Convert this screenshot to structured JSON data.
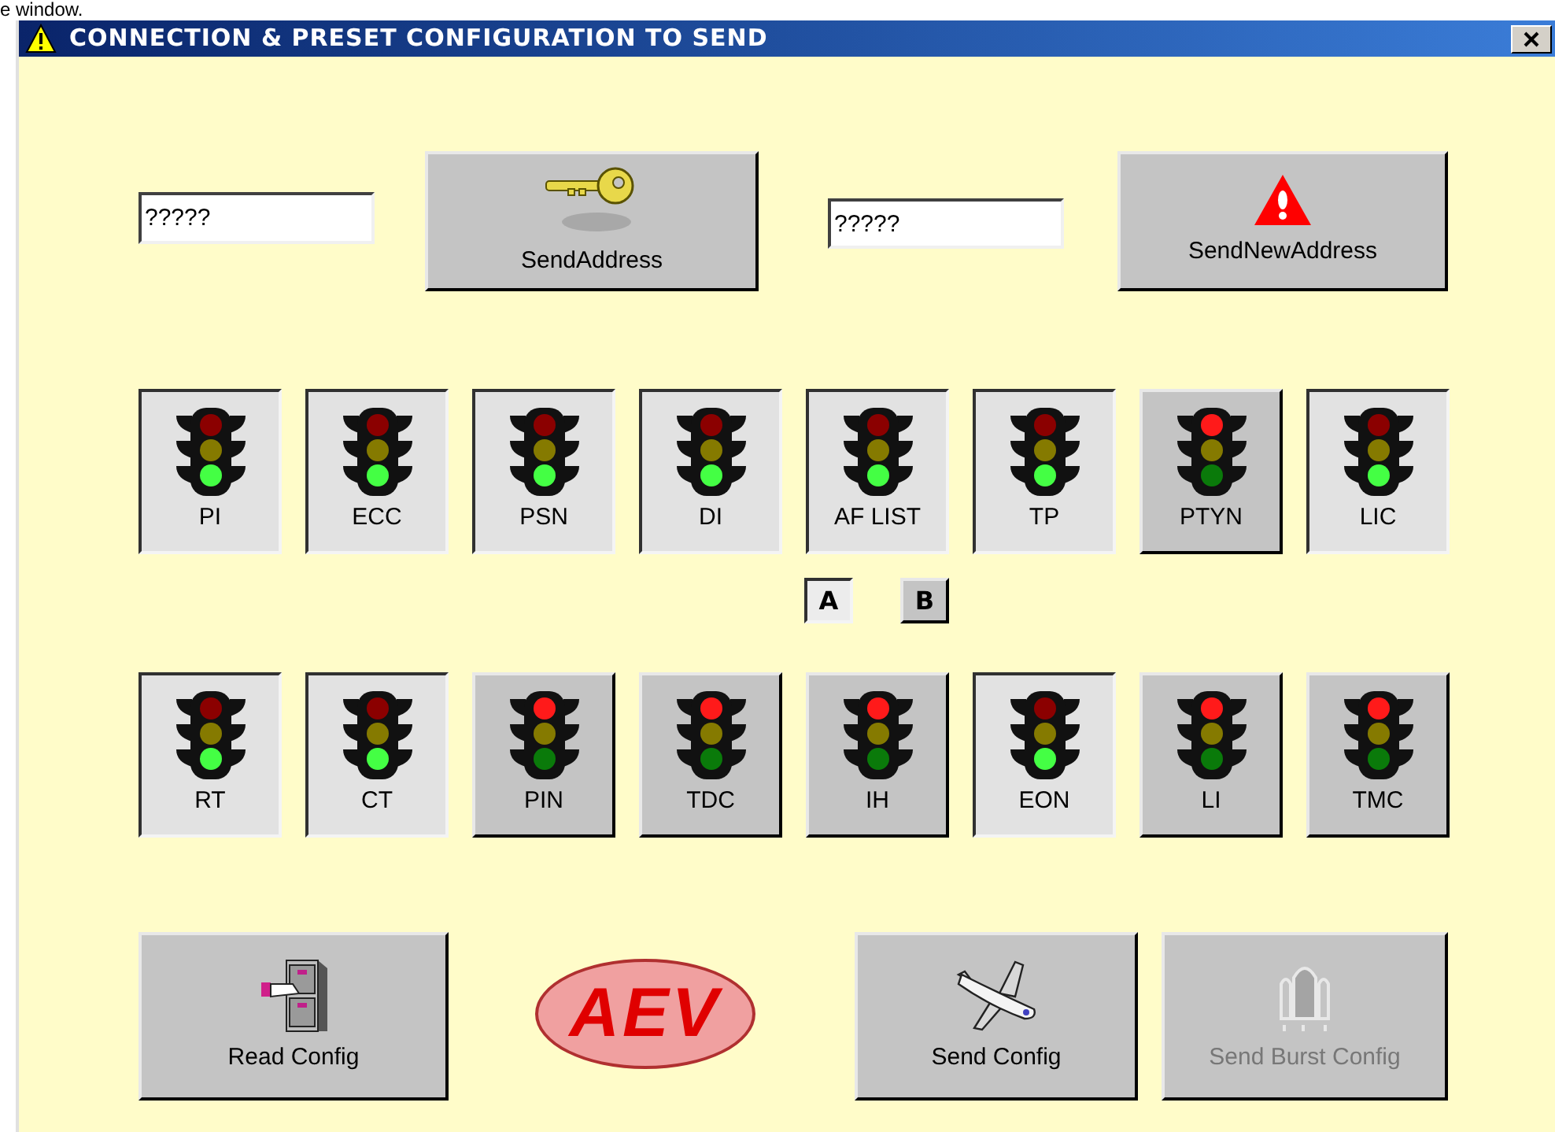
{
  "page_fragment": "e window.",
  "window": {
    "title": "CONNECTION & PRESET CONFIGURATION TO SEND"
  },
  "address": {
    "field": {
      "value": "?????"
    },
    "button": {
      "label": "SendAddress"
    }
  },
  "new_address": {
    "field": {
      "value": "?????"
    },
    "button": {
      "label": "SendNewAddress"
    }
  },
  "toggle_rows": [
    [
      {
        "label": "PI",
        "on": true
      },
      {
        "label": "ECC",
        "on": true
      },
      {
        "label": "PSN",
        "on": true
      },
      {
        "label": "DI",
        "on": true
      },
      {
        "label": "AF LIST",
        "on": true
      },
      {
        "label": "TP",
        "on": true
      },
      {
        "label": "PTYN",
        "on": false
      },
      {
        "label": "LIC",
        "on": true
      }
    ],
    [
      {
        "label": "RT",
        "on": true
      },
      {
        "label": "CT",
        "on": true
      },
      {
        "label": "PIN",
        "on": false
      },
      {
        "label": "TDC",
        "on": false
      },
      {
        "label": "IH",
        "on": false
      },
      {
        "label": "EON",
        "on": true
      },
      {
        "label": "LI",
        "on": false
      },
      {
        "label": "TMC",
        "on": false
      }
    ]
  ],
  "af_list_variants": [
    {
      "label": "A",
      "selected": true
    },
    {
      "label": "B",
      "selected": false
    }
  ],
  "read_button": {
    "label": "Read Config",
    "disabled": false
  },
  "logo": {
    "text": "AEV"
  },
  "send_buttons": [
    {
      "label": "Send Config",
      "disabled": false
    },
    {
      "label": "Send Burst Config",
      "disabled": true
    }
  ]
}
